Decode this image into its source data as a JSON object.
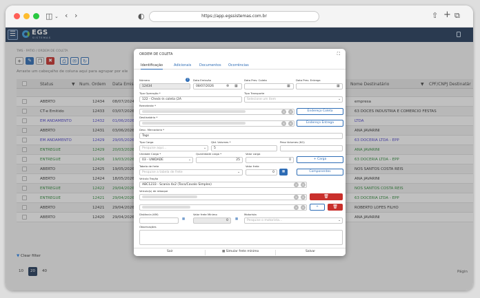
{
  "browser": {
    "url": "https://app.egssistemas.com.br"
  },
  "app": {
    "logo_main": "EGS",
    "logo_sub": "SISTEMAS"
  },
  "breadcrumb": "TMS · PATIO / ORDEM DE COLETA",
  "toolbar": {
    "add": "+",
    "edit": "✎",
    "copy": "❐",
    "delete": "✖",
    "print": "⎙",
    "email": "✉",
    "refresh": "↻"
  },
  "grouping_hint": "Arraste um cabeçalho de coluna aqui para agrupar por ele",
  "table": {
    "headers": {
      "status": "Status",
      "num_ordem": "Num. Ordem",
      "data_emissao": "Data Emis",
      "nome_destinatario": "Nome Destinatário",
      "cpf_cnpj_destinatario": "CPF/CNPJ Destinatár"
    },
    "rows": [
      {
        "status": "ABERTO",
        "color": "#333333",
        "num": "12434",
        "date": "08/07/2024",
        "dest": "empresa",
        "dest_color": "#333333"
      },
      {
        "status": "CT-e Emitido",
        "color": "#333333",
        "num": "12433",
        "date": "03/07/2026",
        "dest": "63 DOCES INDUSTRIA E COMERCIO FESTAS",
        "dest_color": "#333333"
      },
      {
        "status": "EM ANDAMENTO",
        "color": "#4a3fc9",
        "num": "12432",
        "date": "01/06/2026",
        "dest": "LTDA",
        "dest_color": "#4a3fc9"
      },
      {
        "status": "ABERTO",
        "color": "#333333",
        "num": "12431",
        "date": "03/06/2026",
        "dest": "ANA JAVARINI",
        "dest_color": "#333333"
      },
      {
        "status": "EM ANDAMENTO",
        "color": "#4a3fc9",
        "num": "12429",
        "date": "29/05/2026",
        "dest": "63 DOCERIA LTDA - EPP",
        "dest_color": "#4a3fc9"
      },
      {
        "status": "ENTREGUE",
        "color": "#2e8b3a",
        "num": "12429",
        "date": "20/03/2026",
        "dest": "ANA JAVARINI",
        "dest_color": "#2e8b3a"
      },
      {
        "status": "ENTREGUE",
        "color": "#2e8b3a",
        "num": "12426",
        "date": "19/03/2026",
        "dest": "63 DOCERIA LTDA - EPP",
        "dest_color": "#2e8b3a"
      },
      {
        "status": "ABERTO",
        "color": "#333333",
        "num": "12425",
        "date": "19/05/2026",
        "dest": "NOS SANTOS COSTA REIS",
        "dest_color": "#333333"
      },
      {
        "status": "ABERTO",
        "color": "#333333",
        "num": "12424",
        "date": "18/05/2026",
        "dest": "ANA JAVARINI",
        "dest_color": "#333333"
      },
      {
        "status": "ENTREGUE",
        "color": "#2e8b3a",
        "num": "12422",
        "date": "29/04/2026",
        "dest": "NOS SANTOS COSTA REIS",
        "dest_color": "#2e8b3a"
      },
      {
        "status": "ENTREGUE",
        "color": "#2e8b3a",
        "num": "12421",
        "date": "29/04/2026",
        "dest": "63 DOCERIA LTDA - EPP",
        "dest_color": "#2e8b3a"
      },
      {
        "status": "ABERTO",
        "color": "#333333",
        "num": "12421",
        "date": "29/04/2026",
        "dest": "ROBERTO LOFES FILHO",
        "dest_color": "#333333"
      },
      {
        "status": "ABERTO",
        "color": "#333333",
        "num": "12420",
        "date": "29/04/2026",
        "dest": "ANA JAVARINI",
        "dest_color": "#333333"
      }
    ]
  },
  "footer": {
    "clear_filter": "Clear filter",
    "pages": [
      "10",
      "20",
      "40"
    ],
    "active_page": "20",
    "pagina": "Págin"
  },
  "modal": {
    "title": "ORDEM DE COLETA",
    "expand": "⛶",
    "tabs": [
      "Identificação",
      "Adicionais",
      "Documentos",
      "Ocorrências"
    ],
    "numero_label": "Número",
    "numero_value": "12434",
    "data_emissao_label": "Data Emissão",
    "data_emissao_value": "08/07/2026",
    "data_prev_coleta_label": "Data Prev. Coleta",
    "data_prev_entrega_label": "Data Prev. Entrega",
    "tipo_operacao_label": "Tipo Operação *",
    "tipo_operacao_value": "122 - Check-in coleta (2A",
    "tipo_transporte_label": "Tipo Transporte",
    "tipo_transporte_ph": "Selecione um item",
    "remetente_label": "Remetente *",
    "endereco_coleta_btn": "Endereço Coleta",
    "destinatario_label": "Destinatário *",
    "endereco_entrega_btn": "Endereço Entrega",
    "desc_mercadoria_label": "Desc. Mercadoria *",
    "desc_mercadoria_value": "Tags",
    "tipo_carga_label": "Tipo Carga",
    "tipo_carga_ph": "Pesquise aqui...",
    "qtd_volumes_label": "Qtd. Volumes *",
    "qtd_volumes_value": "5",
    "peso_volumes_label": "Peso Volumes (KG)",
    "unidade_carga_label": "Unidade Carga *",
    "unidade_carga_value": "03 - UNIDADE",
    "quantidade_carga_label": "Quantidade carga *",
    "quantidade_carga_value": "25",
    "valor_carga_label": "Valor carga",
    "valor_carga_value": "0",
    "add_carga_btn": "+ Carga",
    "tabela_frete_label": "Tabela de frete",
    "tabela_frete_ph": "Pesquise a tabela de frete",
    "valor_frete_label": "Valor frete",
    "valor_frete_value": "0",
    "componentes_btn": "Componentes",
    "veiculo_tracao_label": "Veículo Tração",
    "veiculo_tracao_value": "ABC1233 - Scania 4x2 (Toco/Cavalo Simples)",
    "veiculos_reboque_label": "Veículo(s) de reboque",
    "distancia_label": "Distância (KM)",
    "valor_frete_minimo_label": "Valor frete Mínimo",
    "valor_frete_minimo_value": "0",
    "motorista_label": "Motorista",
    "motorista_ph": "Pesquise o motorista...",
    "observacoes_label": "Observações",
    "footer_sair": "Sair",
    "footer_simular": "Simular frete mínimo",
    "footer_salvar": "Salvar"
  },
  "colors": {
    "header_bg": "#233a5b",
    "accent": "#2d6cb5",
    "danger": "#c9302c",
    "in_progress": "#4a3fc9",
    "delivered": "#2e8b3a"
  }
}
